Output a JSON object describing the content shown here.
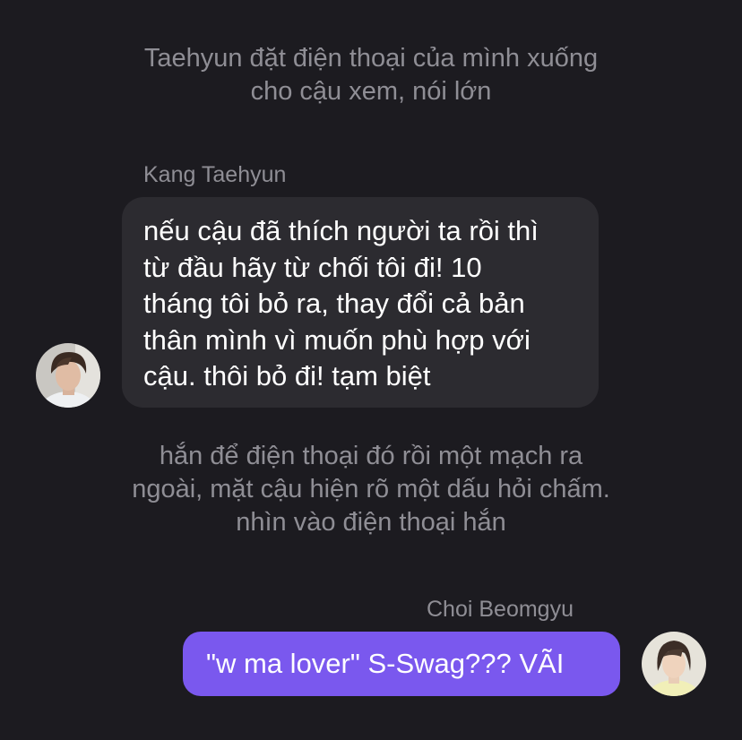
{
  "narration_1": {
    "lines": [
      "Taehyun đặt điện thoại của mình xuống",
      "cho cậu xem, nói lớn"
    ]
  },
  "incoming_message": {
    "sender": "Kang Taehyun",
    "lines": [
      "nếu cậu đã thích người ta rồi thì",
      "từ đầu hãy từ chối tôi đi! 10",
      "tháng tôi bỏ ra, thay đổi cả bản",
      "thân mình vì muốn phù hợp với",
      "cậu. thôi bỏ đi! tạm biệt"
    ],
    "avatar_icon": "person-photo-avatar"
  },
  "narration_2": {
    "lines": [
      "hắn để điện thoại đó rồi một mạch ra",
      "ngoài, mặt cậu hiện rõ một dấu hỏi chấm.",
      "nhìn vào điện thoại hắn"
    ]
  },
  "outgoing_message": {
    "sender": "Choi Beomgyu",
    "text": "\"w ma lover\" S-Swag??? VÃI",
    "avatar_icon": "person-photo-avatar"
  },
  "colors": {
    "background": "#1c1b20",
    "incoming_bubble": "#2c2b30",
    "outgoing_bubble": "#7a58ee",
    "muted_text": "#8f8e95",
    "message_text": "#ffffff"
  }
}
